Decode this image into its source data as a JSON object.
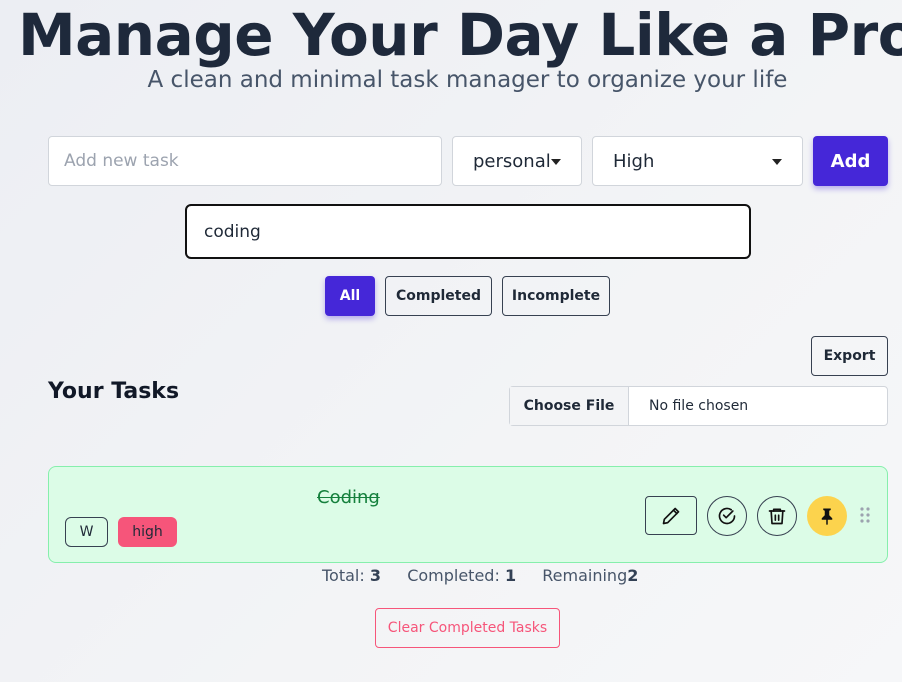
{
  "header": {
    "title": "Manage Your Day Like a Pro",
    "subtitle": "A clean and minimal task manager to organize your life"
  },
  "form": {
    "task_placeholder": "Add new task",
    "category_value": "personal",
    "priority_value": "High",
    "add_label": "Add"
  },
  "search": {
    "value": "coding"
  },
  "filters": {
    "all": "All",
    "completed": "Completed",
    "incomplete": "Incomplete",
    "active": "All"
  },
  "tasks_section": {
    "heading": "Your Tasks",
    "export_label": "Export",
    "choose_file_label": "Choose File",
    "file_status": "No file chosen"
  },
  "tasks": [
    {
      "text": "Coding",
      "completed": true,
      "category_tag": "W",
      "priority_tag": "high",
      "pinned": true,
      "actions": [
        "pencil-icon",
        "check-circle-icon",
        "trash-icon",
        "pin-icon",
        "drag-handle-icon"
      ]
    }
  ],
  "stats": {
    "total_label": "Total:",
    "total_value": "3",
    "completed_label": "Completed:",
    "completed_value": "1",
    "remaining_label": "Remaining",
    "remaining_value": "2"
  },
  "clear_label": "Clear Completed Tasks",
  "colors": {
    "accent": "#4527d8",
    "completed_card_bg": "#dcfce7",
    "priority_high": "#f6557a",
    "pin_active": "#fcd34d"
  }
}
